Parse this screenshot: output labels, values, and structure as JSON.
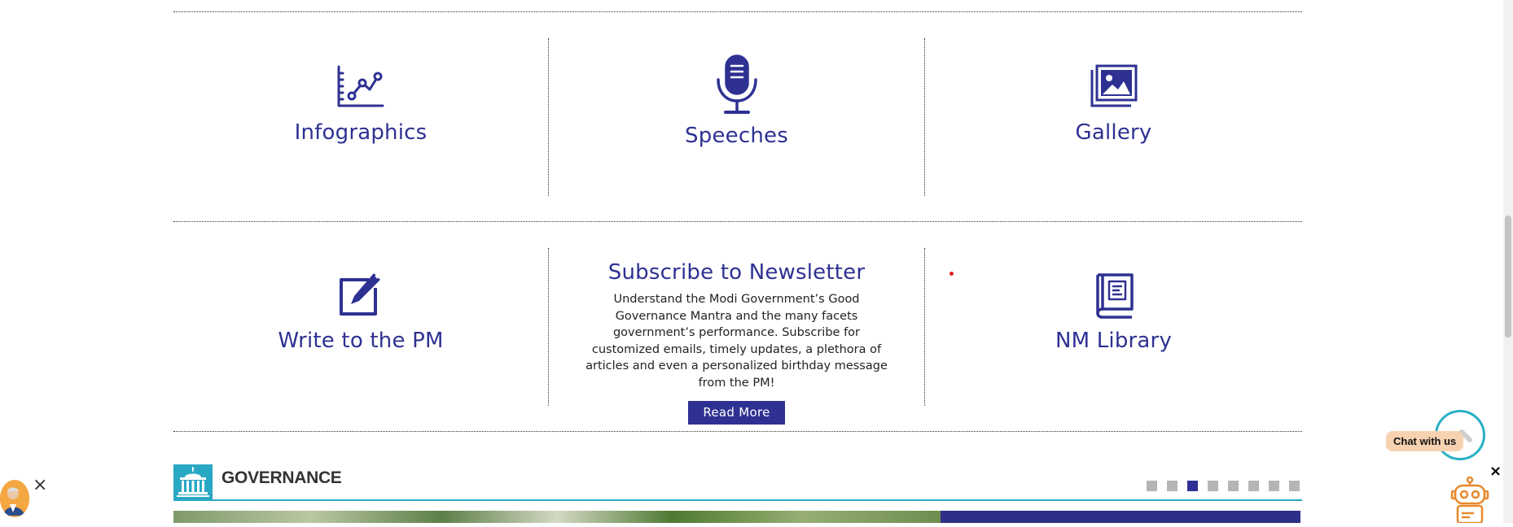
{
  "tiles": {
    "infographics": {
      "label": "Infographics"
    },
    "speeches": {
      "label": "Speeches"
    },
    "gallery": {
      "label": "Gallery"
    },
    "write_pm": {
      "label": "Write to the PM"
    },
    "newsletter": {
      "label": "Subscribe to Newsletter",
      "description": "Understand the Modi Government’s Good Governance Mantra and the many facets government’s performance. Subscribe for customized emails, timely updates, a plethora of articles and even a personalized birthday message from the PM!",
      "button_label": "Read More"
    },
    "library": {
      "label": "NM Library"
    }
  },
  "governance": {
    "title": "GOVERNANCE",
    "carousel": {
      "total": 8,
      "active_index": 3
    }
  },
  "chat": {
    "label": "Chat with us",
    "close_glyph": "×"
  },
  "left_widget": {
    "close_glyph": "×"
  },
  "colors": {
    "brand": "#2e3192",
    "teal": "#29a8c4",
    "chat_bg": "#f7d2b0",
    "robot": "#e8892c"
  },
  "icons": [
    "chart-icon",
    "microphone-icon",
    "gallery-icon",
    "edit-icon",
    "book-icon",
    "government-building-icon",
    "robot-icon",
    "avatar-icon",
    "scroll-up-icon"
  ]
}
